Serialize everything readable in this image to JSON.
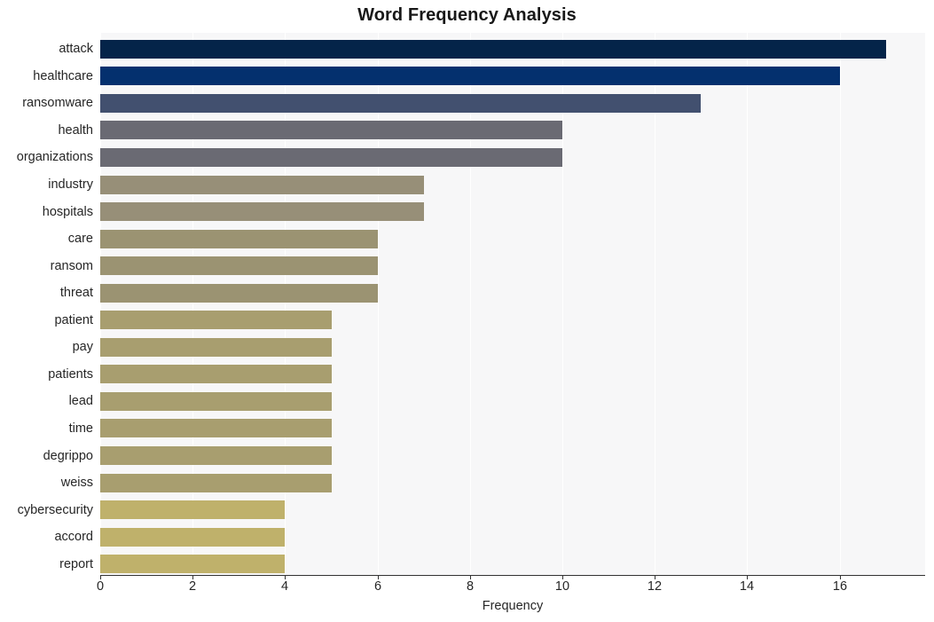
{
  "chart_data": {
    "type": "bar",
    "orientation": "horizontal",
    "title": "Word Frequency Analysis",
    "xlabel": "Frequency",
    "ylabel": "",
    "xlim": [
      0,
      17.85
    ],
    "xticks": [
      0,
      2,
      4,
      6,
      8,
      10,
      12,
      14,
      16
    ],
    "xtick_labels": [
      "0",
      "2",
      "4",
      "6",
      "8",
      "10",
      "12",
      "14",
      "16"
    ],
    "grid": true,
    "grid_axis": "x",
    "legend": null,
    "categories": [
      "attack",
      "healthcare",
      "ransomware",
      "health",
      "organizations",
      "industry",
      "hospitals",
      "care",
      "ransom",
      "threat",
      "patient",
      "pay",
      "patients",
      "lead",
      "time",
      "degrippo",
      "weiss",
      "cybersecurity",
      "accord",
      "report"
    ],
    "values": [
      17,
      16,
      13,
      10,
      10,
      7,
      7,
      6,
      6,
      6,
      5,
      5,
      5,
      5,
      5,
      5,
      5,
      4,
      4,
      4
    ],
    "bar_colors": [
      "#042449",
      "#04306e",
      "#42506f",
      "#6a6a73",
      "#6a6a73",
      "#978f78",
      "#978f78",
      "#9b9372",
      "#9b9372",
      "#9b9372",
      "#a89e6f",
      "#a89e6f",
      "#a89e6f",
      "#a89e6f",
      "#a89e6f",
      "#a89e6f",
      "#a89e6f",
      "#bfb16b",
      "#bfb16b",
      "#bfb16b"
    ],
    "plot_background": "#f7f7f8",
    "figure_background": "#ffffff",
    "gridline_color": "#ffffff",
    "axis_color": "#333333",
    "text_color": "#262626",
    "title_color": "#181818"
  }
}
